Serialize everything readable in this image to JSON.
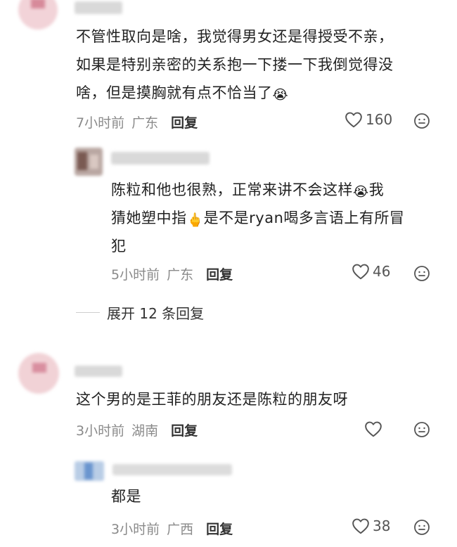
{
  "comments": [
    {
      "text_lines": [
        "不管性取向是啥，我觉得男女还是得授受不亲，",
        "如果是特别亲密的关系抱一下搂一下我倒觉得没",
        "啥，但是摸胸就有点不恰当了"
      ],
      "emoji": "😭",
      "time": "7小时前",
      "location": "广东",
      "reply_label": "回复",
      "likes": "160"
    },
    {
      "text_line1_a": "陈粒和他也很熟，正常来讲不会这样",
      "text_line1_b": "我",
      "text_line2_a": "猜她塑中指",
      "text_line2_b": "是不是ryan喝多言语上有所冒",
      "text_line3": "犯",
      "emoji": "😭",
      "emoji2": "🖕",
      "time": "5小时前",
      "location": "广东",
      "reply_label": "回复",
      "likes": "46"
    },
    {
      "text": "这个男的是王菲的朋友还是陈粒的朋友呀",
      "time": "3小时前",
      "location": "湖南",
      "reply_label": "回复",
      "likes": ""
    },
    {
      "text": "都是",
      "time": "3小时前",
      "location": "广西",
      "reply_label": "回复",
      "likes": "38"
    }
  ],
  "expand_replies": "展开 12 条回复",
  "icons": {
    "like": "heart-outline-icon",
    "emoji_face": "smiley-face-icon"
  },
  "colors": {
    "meta_gray": "#8a8a8a",
    "text": "#222222",
    "background": "#ffffff"
  }
}
